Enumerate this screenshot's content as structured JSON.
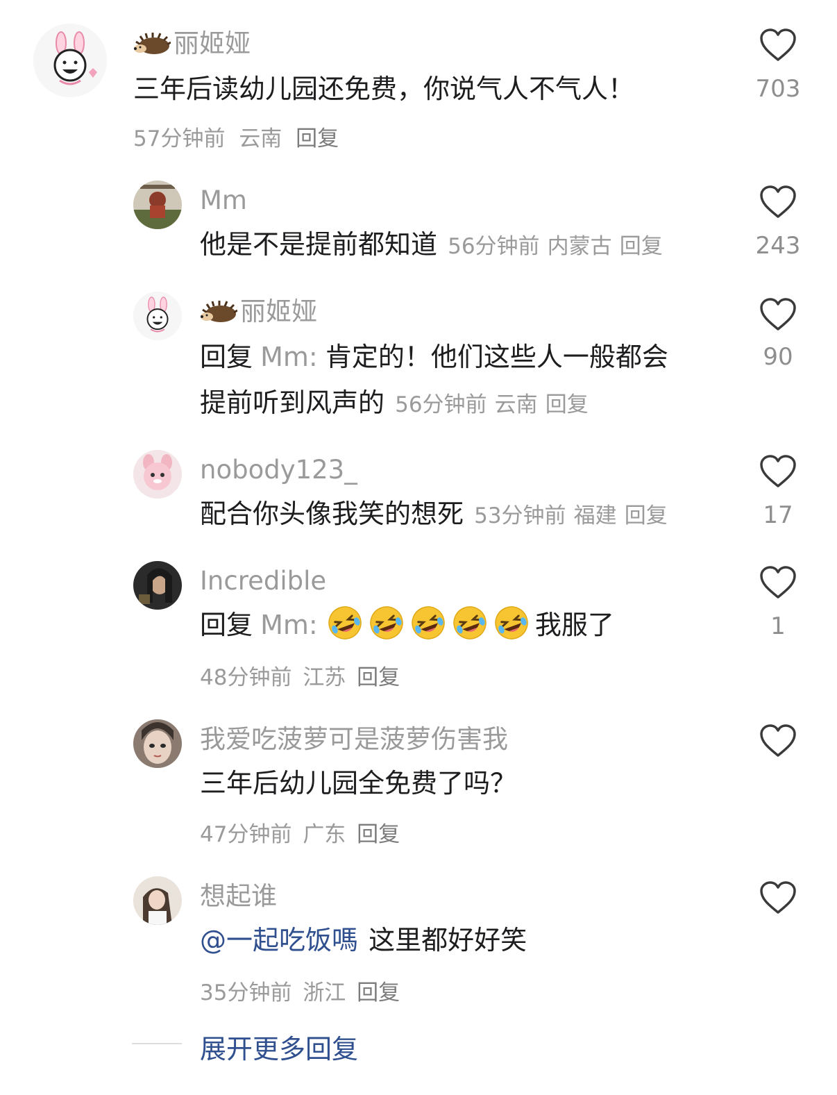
{
  "comments": [
    {
      "username": "丽姬娅",
      "text": "三年后读幼儿园还免费，你说气人不气人！",
      "time": "57分钟前",
      "location": "云南",
      "reply_label": "回复",
      "likes": "703"
    },
    {
      "username": "Mm",
      "text": "他是不是提前都知道",
      "time": "56分钟前",
      "location": "内蒙古",
      "reply_label": "回复",
      "likes": "243"
    },
    {
      "username": "丽姬娅",
      "reply_prefix": "回复",
      "mention": "Mm:",
      "text_line1": "肯定的！他们这些人一般都会",
      "text_line2": "提前听到风声的",
      "time": "56分钟前",
      "location": "云南",
      "reply_label": "回复",
      "likes": "90"
    },
    {
      "username": "nobody123_",
      "text": "配合你头像我笑的想死",
      "time": "53分钟前",
      "location": "福建",
      "reply_label": "回复",
      "likes": "17"
    },
    {
      "username": "Incredible",
      "reply_prefix": "回复",
      "mention": "Mm:",
      "emoji_name": "rolling-on-floor-laughing-emoji",
      "emoji_count": 5,
      "text": "我服了",
      "time": "48分钟前",
      "location": "江苏",
      "reply_label": "回复",
      "likes": "1"
    },
    {
      "username": "我爱吃菠萝可是菠萝伤害我",
      "text": "三年后幼儿园全免费了吗？",
      "time": "47分钟前",
      "location": "广东",
      "reply_label": "回复",
      "likes": ""
    },
    {
      "username": "想起谁",
      "mention_link": "@一起吃饭嗎",
      "text": "这里都好好笑",
      "time": "35分钟前",
      "location": "浙江",
      "reply_label": "回复",
      "likes": ""
    }
  ],
  "expand_more": "展开更多回复",
  "icons": {
    "like": "heart-outline-icon",
    "badge": "hedgehog-icon"
  },
  "colors": {
    "link": "#2f4f8f",
    "secondary_text": "#9a9a9a",
    "primary_text": "#1d1d1f"
  }
}
